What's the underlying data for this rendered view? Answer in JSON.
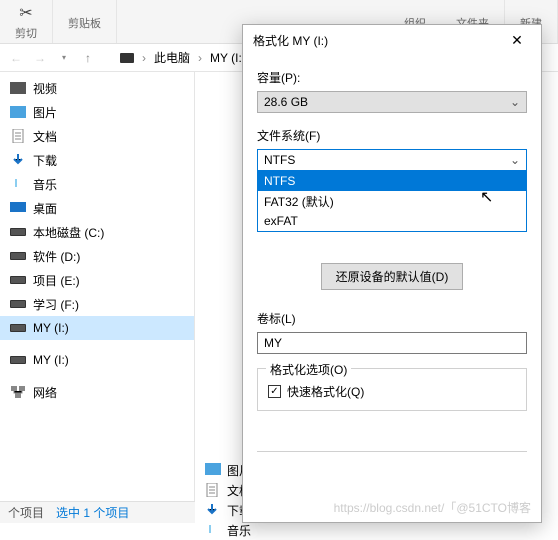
{
  "ribbon": {
    "cut_label": "剪切",
    "clipboard_label": "剪贴板",
    "organize_label": "组织",
    "filetype_label": "文件夹",
    "new_label": "新建"
  },
  "address": {
    "pc": "此电脑",
    "drive": "MY (I:)"
  },
  "tree": [
    {
      "icon": "video",
      "label": "视频",
      "color": "#555"
    },
    {
      "icon": "image",
      "label": "图片",
      "color": "#1a73c7"
    },
    {
      "icon": "doc",
      "label": "文档",
      "color": "#555"
    },
    {
      "icon": "download",
      "label": "下载",
      "color": "#1a73c7"
    },
    {
      "icon": "music",
      "label": "音乐",
      "color": "#1a9de0"
    },
    {
      "icon": "desktop",
      "label": "桌面",
      "color": "#1a73c7"
    },
    {
      "icon": "drive",
      "label": "本地磁盘 (C:)",
      "color": "#555"
    },
    {
      "icon": "drive",
      "label": "软件 (D:)",
      "color": "#555"
    },
    {
      "icon": "drive",
      "label": "项目 (E:)",
      "color": "#555"
    },
    {
      "icon": "drive",
      "label": "学习 (F:)",
      "color": "#555"
    },
    {
      "icon": "drive",
      "label": "MY (I:)",
      "color": "#555",
      "selected": true
    },
    {
      "gap": true
    },
    {
      "icon": "drive",
      "label": "MY (I:)",
      "color": "#555"
    },
    {
      "gap": true
    },
    {
      "icon": "network",
      "label": "网络",
      "color": "#555"
    }
  ],
  "status": {
    "count": "个项目",
    "selected": "选中 1 个项目"
  },
  "bg_items": [
    {
      "label": "图片",
      "icon": "image"
    },
    {
      "label": "文档",
      "icon": "doc"
    },
    {
      "label": "下载",
      "icon": "download"
    },
    {
      "label": "音乐",
      "icon": "music"
    }
  ],
  "dialog": {
    "title": "格式化 MY (I:)",
    "capacity_label": "容量(P):",
    "capacity_value": "28.6 GB",
    "fs_label": "文件系统(F)",
    "fs_value": "NTFS",
    "fs_options": [
      "NTFS",
      "FAT32 (默认)",
      "exFAT"
    ],
    "restore_btn": "还原设备的默认值(D)",
    "vol_label": "卷标(L)",
    "vol_value": "MY",
    "opts_legend": "格式化选项(O)",
    "quick_label": "快速格式化(Q)",
    "quick_checked": true
  },
  "watermark": "https://blog.csdn.net/「@51CTO博客"
}
